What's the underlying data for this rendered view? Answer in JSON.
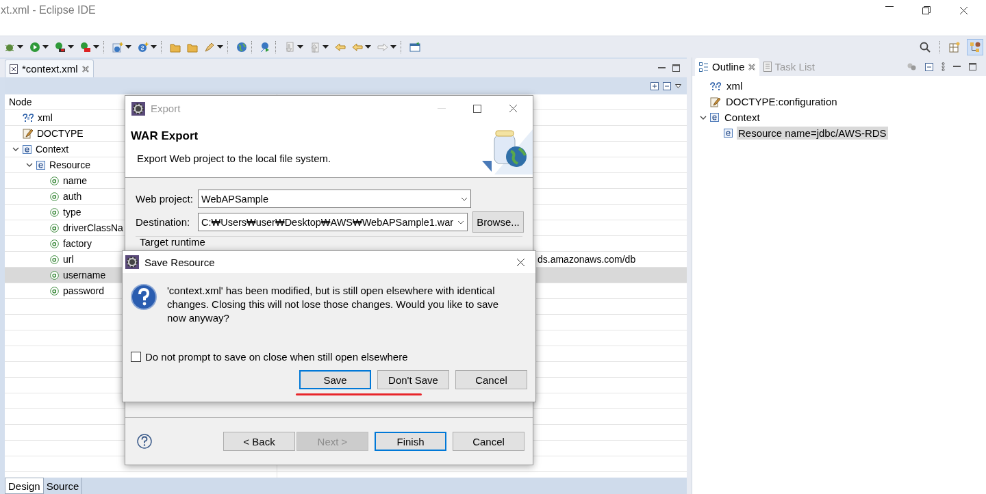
{
  "window": {
    "title": "xt.xml - Eclipse IDE"
  },
  "editor": {
    "tabs": [
      {
        "label": "*context.xml",
        "selected": true
      }
    ],
    "columns": [
      "Node"
    ],
    "tree": [
      {
        "label": "xml",
        "kind": "pi",
        "selected": false
      },
      {
        "label": "DOCTYPE",
        "kind": "doctype",
        "selected": false
      },
      {
        "label": "Context",
        "kind": "element",
        "selected": false,
        "expanded": true,
        "children": [
          {
            "label": "Resource",
            "kind": "element",
            "selected": false,
            "expanded": true,
            "children": [
              {
                "label": "name",
                "kind": "attribute",
                "selected": false
              },
              {
                "label": "auth",
                "kind": "attribute",
                "selected": false
              },
              {
                "label": "type",
                "kind": "attribute",
                "selected": false
              },
              {
                "label": "driverClassNa",
                "kind": "attribute",
                "selected": false
              },
              {
                "label": "factory",
                "kind": "attribute",
                "selected": false
              },
              {
                "label": "url",
                "kind": "attribute",
                "selected": false,
                "value": "ds.amazonaws.com/db"
              },
              {
                "label": "username",
                "kind": "attribute",
                "selected": true
              },
              {
                "label": "password",
                "kind": "attribute",
                "selected": false
              }
            ]
          }
        ]
      }
    ],
    "bottom_tabs": [
      {
        "label": "Design",
        "selected": true
      },
      {
        "label": "Source",
        "selected": false
      }
    ]
  },
  "outline": {
    "tabs": [
      {
        "label": "Outline",
        "selected": true
      },
      {
        "label": "Task List",
        "selected": false
      }
    ],
    "tree": [
      {
        "label": "xml",
        "kind": "pi",
        "selected": false
      },
      {
        "label": "DOCTYPE:configuration",
        "kind": "doctype",
        "selected": false
      },
      {
        "label": "Context",
        "kind": "element",
        "selected": false,
        "expanded": true,
        "children": [
          {
            "label": "Resource name=jdbc/AWS-RDS",
            "kind": "element",
            "selected": true
          }
        ]
      }
    ]
  },
  "export_dialog": {
    "title": "Export",
    "heading": "WAR Export",
    "description": "Export Web project to the local file system.",
    "fields": [
      {
        "label": "Web project:",
        "value": "WebAPSample"
      },
      {
        "label": "Destination:",
        "value": "C:₩Users₩user₩Desktop₩AWS₩WebAPSample1.war",
        "button": "Browse..."
      }
    ],
    "group_label": "Target runtime",
    "buttons": [
      {
        "label": "< Back",
        "disabled": false,
        "default": false
      },
      {
        "label": "Next >",
        "disabled": true,
        "default": false
      },
      {
        "label": "Finish",
        "disabled": false,
        "default": true
      },
      {
        "label": "Cancel",
        "disabled": false,
        "default": false
      }
    ]
  },
  "save_dialog": {
    "title": "Save Resource",
    "message": "'context.xml' has been modified, but is still open elsewhere with identical changes. Closing this will not lose those changes. Would you like to save now anyway?",
    "checkbox": {
      "label": "Do not prompt to save on close when still open elsewhere",
      "checked": false
    },
    "buttons": [
      {
        "label": "Save",
        "default": true
      },
      {
        "label": "Don't Save",
        "default": false
      },
      {
        "label": "Cancel",
        "default": false
      }
    ]
  }
}
